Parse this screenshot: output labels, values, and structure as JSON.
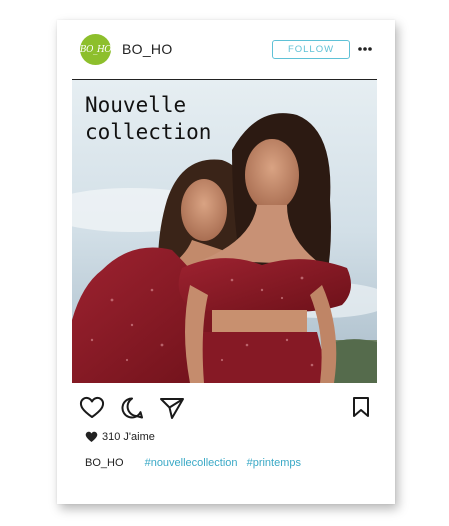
{
  "post": {
    "avatar_text": "BO_HO",
    "username": "BO_HO",
    "follow_label": "FOLLOW",
    "image_caption": "Nouvelle\ncollection",
    "likes_text": "310 J'aime",
    "caption_user": "BO_HO",
    "hashtags": [
      "#nouvellecollection",
      "#printemps"
    ]
  },
  "colors": {
    "avatar_bg": "#8dbf2c",
    "follow_accent": "#5fc1d6",
    "hashtag": "#3aa9c6",
    "dress": "#8e1b26"
  },
  "icons": [
    "more-icon",
    "heart-icon",
    "comment-icon",
    "share-icon",
    "bookmark-icon",
    "heart-filled-icon"
  ]
}
